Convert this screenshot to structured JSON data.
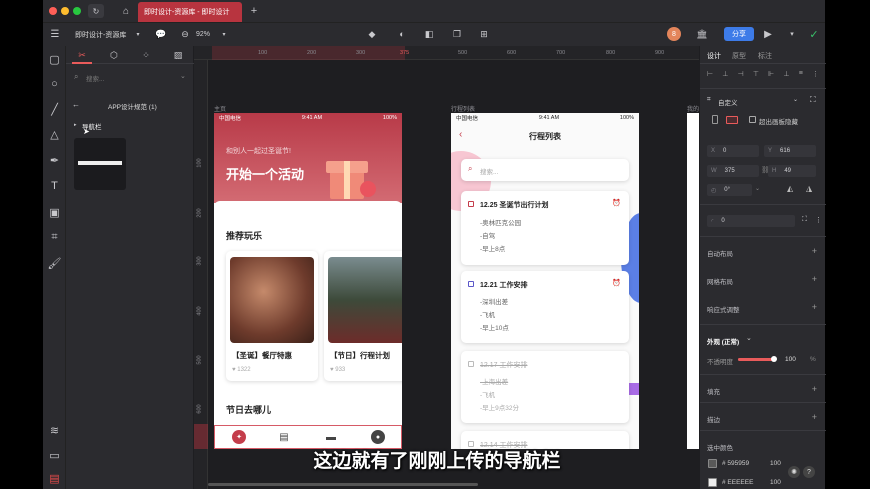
{
  "window": {
    "tab_title": "即时设计-资源库 - 即时设计",
    "file_name": "即时设计-资源库",
    "zoom": "92%",
    "user_initial": "8"
  },
  "toolbar": {
    "share_label": "分享"
  },
  "layers": {
    "search_placeholder": "搜索...",
    "page_name": "APP设计规范 (1)",
    "layer_name": "导航栏"
  },
  "ruler_top": [
    "100",
    "200",
    "300",
    "375",
    "500",
    "600",
    "700",
    "800",
    "900"
  ],
  "ruler_left": [
    "100",
    "200",
    "300",
    "400",
    "500",
    "600"
  ],
  "right_panel": {
    "tabs": [
      "设计",
      "原型",
      "标注"
    ],
    "frame_preset": "自定义",
    "clip_label": "超出画板隐藏",
    "x": "0",
    "y": "616",
    "w": "375",
    "h": "49",
    "rotation": "0°",
    "radius": "0",
    "sections": [
      "自动布局",
      "网格布局",
      "响应式调整"
    ],
    "appearance": "外观 (正常)",
    "opacity_label": "不透明度",
    "opacity": "100",
    "opacity_unit": "%",
    "fill": "填充",
    "stroke": "描边",
    "selected_colors": "选中颜色",
    "colors": [
      {
        "hex": "# 595959",
        "alpha": "100"
      },
      {
        "hex": "# EEEEEE",
        "alpha": "100"
      }
    ],
    "color_values": [
      "#595959",
      "#EEEEEE"
    ]
  },
  "board1": {
    "label": "主页",
    "carrier": "中国电信",
    "time": "9:41 AM",
    "battery": "100%",
    "greeting": "和别人一起过圣诞节!",
    "headline": "开始一个活动",
    "section1": "推荐玩乐",
    "cards": [
      {
        "title": "【圣诞】餐厅特惠",
        "likes": "1322"
      },
      {
        "title": "【节日】行程计划",
        "likes": "933"
      }
    ],
    "section2": "节日去哪儿",
    "nav_icons": [
      "compass-icon",
      "document-icon",
      "message-icon",
      "profile-icon"
    ]
  },
  "board2": {
    "label": "行程列表",
    "carrier": "中国电信",
    "time": "9:41 AM",
    "battery": "100%",
    "title": "行程列表",
    "search_placeholder": "搜索...",
    "items": [
      {
        "date": "12.25 圣诞节出行计划",
        "lines": [
          "-奥林匹克公园",
          "-自驾",
          "-早上8点"
        ],
        "done": false
      },
      {
        "date": "12.21 工作安排",
        "lines": [
          "-深圳出差",
          "-飞机",
          "-早上10点"
        ],
        "done": false
      },
      {
        "date": "12.17 工作安排",
        "lines": [
          "-上海出差",
          "-飞机",
          "-早上9点32分"
        ],
        "done": true
      },
      {
        "date": "12.14 工作安排",
        "lines": [],
        "done": true
      }
    ]
  },
  "board3": {
    "label": "我的"
  },
  "subtitle": "这边就有了刚刚上传的导航栏",
  "colors": {
    "brand_red": "#b8343f",
    "primary_blue": "#3d7be8",
    "panel": "#2b2b2f",
    "canvas": "#1e1e21"
  }
}
